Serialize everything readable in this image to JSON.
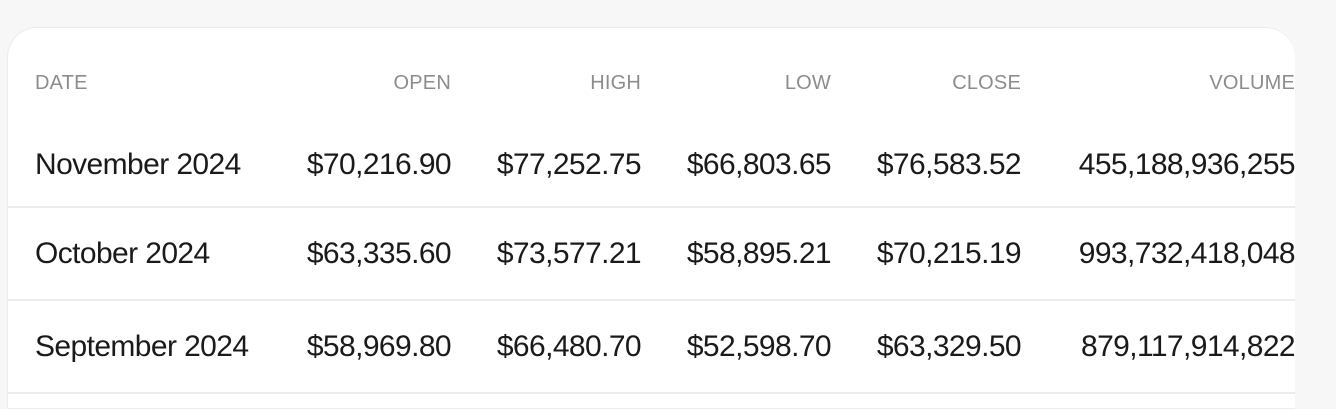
{
  "table": {
    "headers": [
      "DATE",
      "OPEN",
      "HIGH",
      "LOW",
      "CLOSE",
      "VOLUME"
    ],
    "rows": [
      {
        "date": "November 2024",
        "open": "$70,216.90",
        "high": "$77,252.75",
        "low": "$66,803.65",
        "close": "$76,583.52",
        "volume": "455,188,936,255"
      },
      {
        "date": "October 2024",
        "open": "$63,335.60",
        "high": "$73,577.21",
        "low": "$58,895.21",
        "close": "$70,215.19",
        "volume": "993,732,418,048"
      },
      {
        "date": "September 2024",
        "open": "$58,969.80",
        "high": "$66,480.70",
        "low": "$52,598.70",
        "close": "$63,329.50",
        "volume": "879,117,914,822"
      }
    ]
  }
}
